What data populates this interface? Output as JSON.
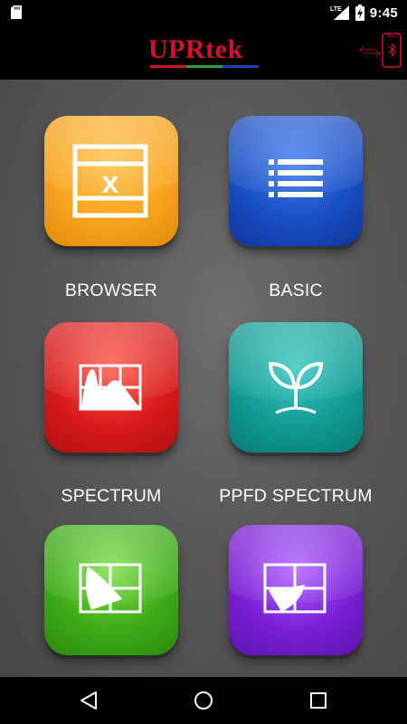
{
  "status_bar": {
    "time": "9:45",
    "network": "LTE",
    "icons": [
      "sd-card-icon",
      "lte-signal-icon",
      "battery-charging-icon"
    ]
  },
  "app_bar": {
    "logo_text": "UPRtek",
    "logo_color": "#d3112a",
    "logo_stripe_colors": [
      "#d3112a",
      "#1fa33a",
      "#1d3fb8"
    ],
    "bluetooth_icon": "bluetooth-connect-icon"
  },
  "tiles": [
    {
      "label": "BROWSER",
      "icon": "excel-x-icon",
      "color": "#f5a21f"
    },
    {
      "label": "BASIC",
      "icon": "list-icon",
      "color": "#1a4fc4"
    },
    {
      "label": "SPECTRUM",
      "icon": "spectrum-chart-icon",
      "color": "#d91b1b"
    },
    {
      "label": "PPFD SPECTRUM",
      "icon": "plant-sprout-icon",
      "color": "#0f9a93"
    },
    {
      "label": "",
      "icon": "cie-diagram-icon",
      "color": "#3dab17"
    },
    {
      "label": "",
      "icon": "cie-diagram-icon",
      "color": "#7a1fd6"
    }
  ],
  "nav_bar": {
    "icons": [
      "back-icon",
      "home-icon",
      "recents-icon"
    ]
  }
}
